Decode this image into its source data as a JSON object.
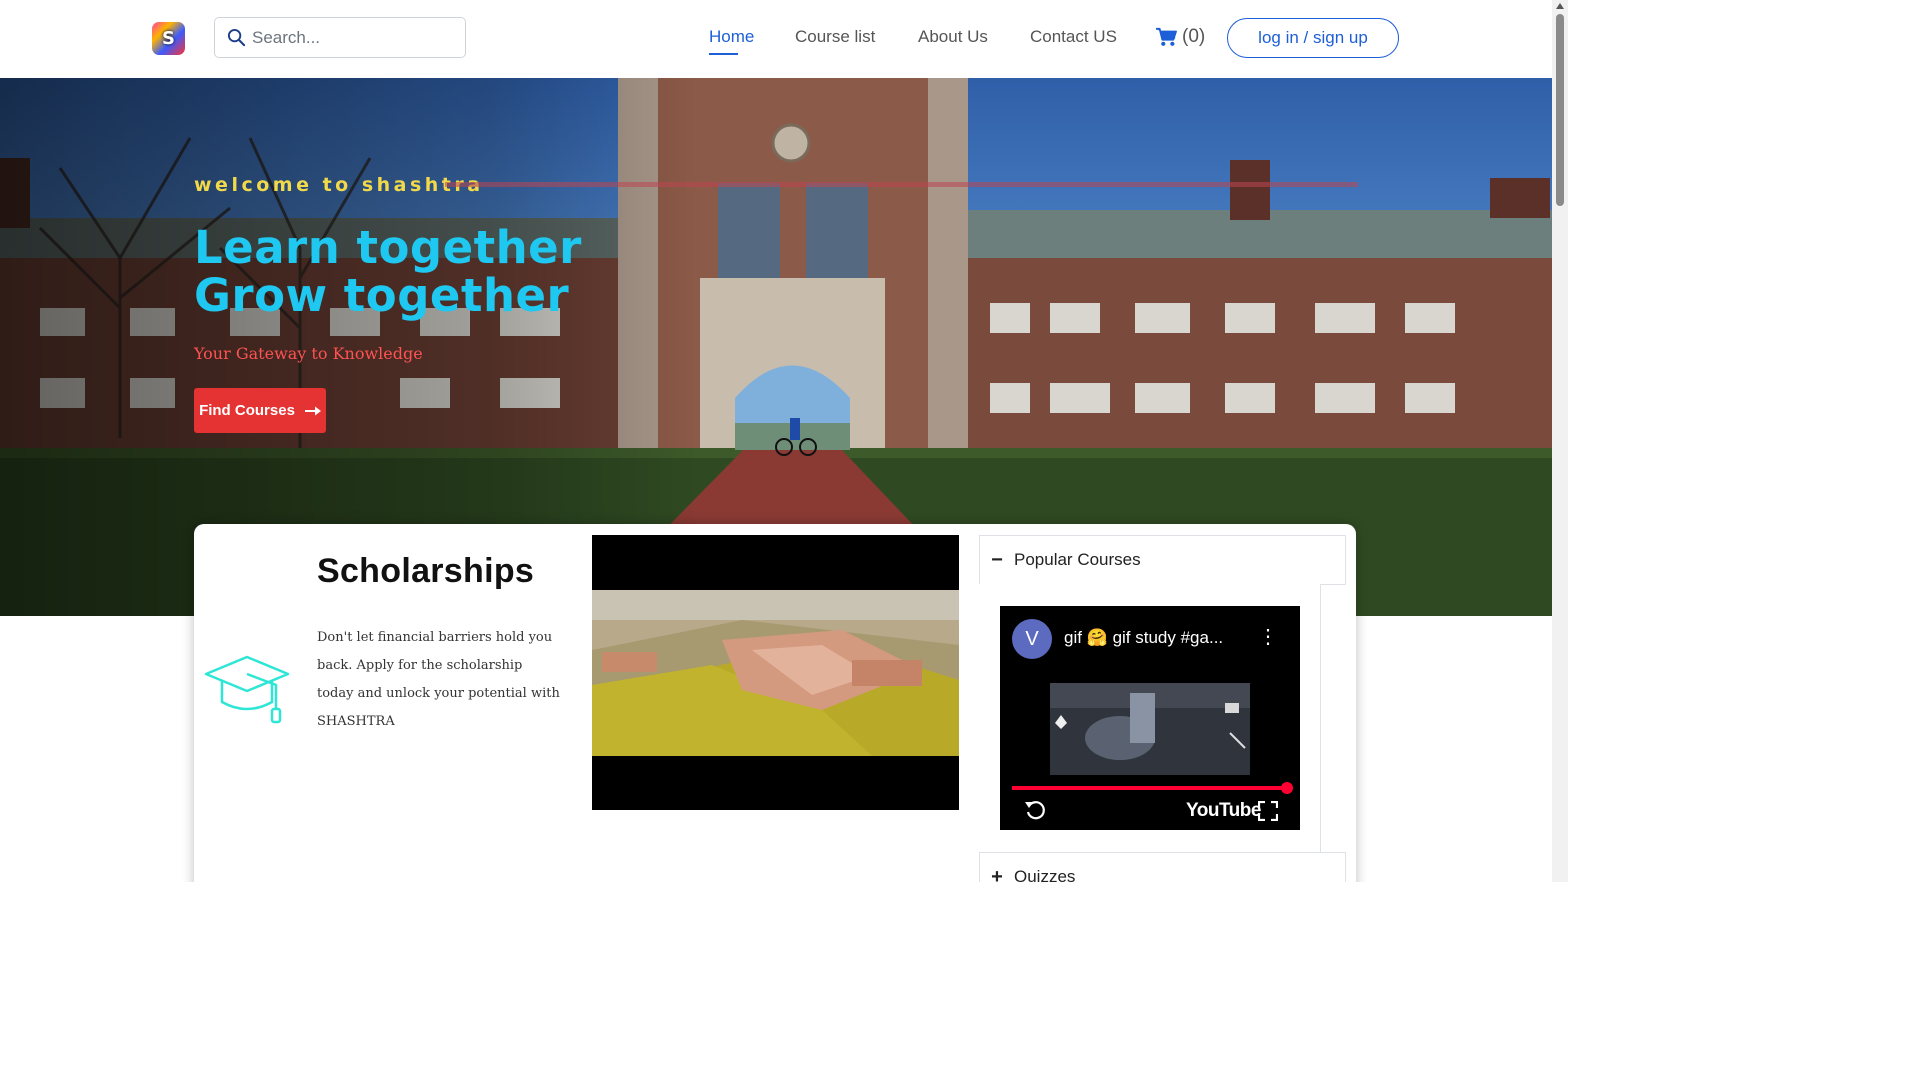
{
  "navbar": {
    "logo_letter": "S",
    "search_placeholder": "Search...",
    "links": [
      "Home",
      "Course list",
      "About Us",
      "Contact US"
    ],
    "active_link": "Home",
    "cart_count": "(0)",
    "login_label": "log in / sign up"
  },
  "hero": {
    "welcome": "welcome to shashtra",
    "headline_line1": "Learn together",
    "headline_line2": "Grow together",
    "tagline": "Your Gateway to Knowledge",
    "cta_label": "Find Courses"
  },
  "scholarships": {
    "title": "Scholarships",
    "description": "Don't let financial barriers hold you back. Apply for the scholarship today and unlock your potential with SHASHTRA"
  },
  "sidebar": {
    "accordion": [
      {
        "label": "Popular Courses",
        "expanded": true,
        "sign": "−"
      },
      {
        "label": "Quizzes",
        "expanded": false,
        "sign": "+"
      }
    ],
    "video": {
      "channel_initial": "V",
      "title": "gif 🤗 gif study #ga...",
      "brand": "YouTube",
      "progress": 1.0
    }
  },
  "colors": {
    "primary": "#1d5fd6",
    "accent_cyan": "#1ec8f0",
    "welcome_yellow": "#f2d94a",
    "cta_red": "#e53232",
    "tagline_red": "#ff5252",
    "icon_teal": "#2ee6d6"
  },
  "icons": {
    "search": "search-icon",
    "cart": "cart-icon",
    "arrow": "arrow-right-icon",
    "graduation": "graduation-cap-icon",
    "replay": "replay-icon",
    "fullscreen": "fullscreen-icon",
    "more": "more-vertical-icon"
  }
}
